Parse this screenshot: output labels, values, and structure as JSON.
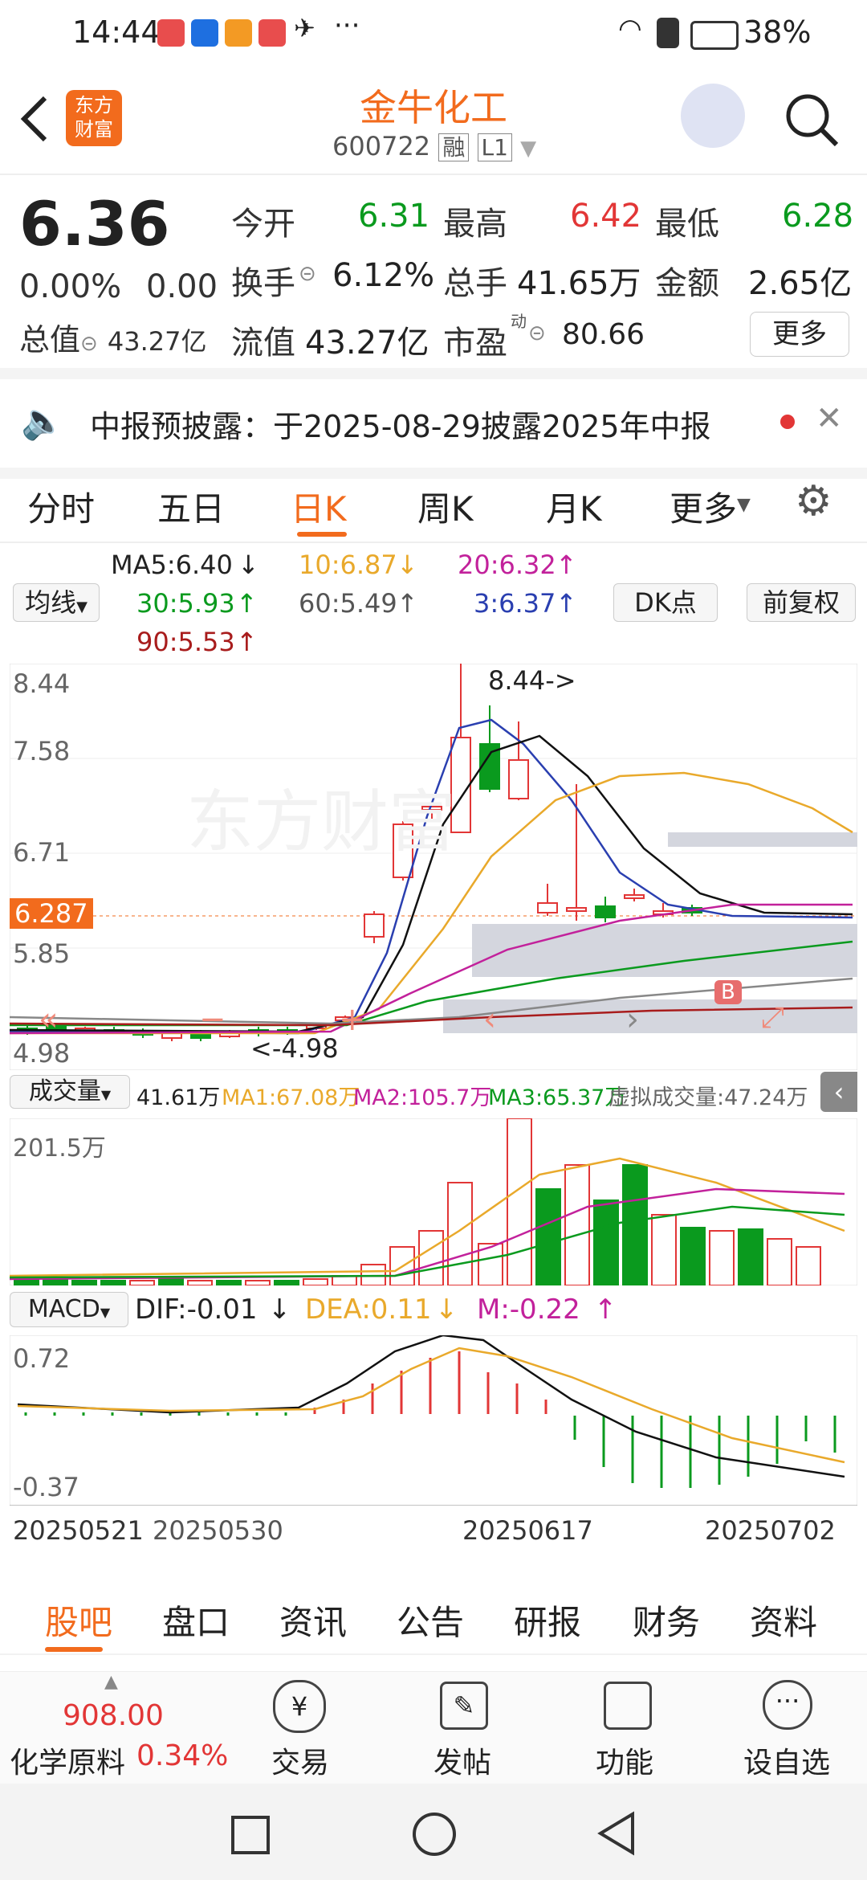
{
  "status": {
    "time": "14:44",
    "battery": "38%"
  },
  "header": {
    "title": "金牛化工",
    "code": "600722",
    "tag1": "融",
    "tag2": "L1",
    "logo_line1": "东方",
    "logo_line2": "财富"
  },
  "quote": {
    "price": "6.36",
    "change_pct": "0.00%",
    "change": "0.00",
    "open_label": "今开",
    "open": "6.31",
    "high_label": "最高",
    "high": "6.42",
    "low_label": "最低",
    "low": "6.28",
    "turnover_label": "换手",
    "turnover": "6.12%",
    "volume_label": "总手",
    "volume": "41.65万",
    "amount_label": "金额",
    "amount": "2.65亿",
    "mktcap_label": "总值",
    "mktcap": "43.27亿",
    "float_label": "流值",
    "float": "43.27亿",
    "pe_label": "市盈",
    "pe_sup": "动",
    "pe": "80.66",
    "more_label": "更多"
  },
  "notice": {
    "text": "中报预披露：于2025-08-29披露2025年中报"
  },
  "tabs": [
    "分时",
    "五日",
    "日K",
    "周K",
    "月K",
    "更多"
  ],
  "ma": {
    "selector": "均线",
    "ma5": "MA5:6.40",
    "ma10": "10:6.87",
    "ma20": "20:6.32",
    "ma30": "30:5.93",
    "ma60": "60:5.49",
    "ma3": "3:6.37",
    "ma90": "90:5.53",
    "dk_label": "DK点",
    "adjust_label": "前复权"
  },
  "kline": {
    "y_ticks": [
      "8.44",
      "7.58",
      "6.71",
      "5.85",
      "4.98"
    ],
    "current_price_tag": "6.287",
    "high_annot": "8.44->",
    "low_annot": "<-4.98",
    "watermark": "东方财富",
    "b_marker": "B"
  },
  "volume": {
    "selector": "成交量",
    "vol": "41.61万",
    "ma1": "MA1:67.08万",
    "ma2": "MA2:105.7万",
    "ma3": "MA3:65.37万",
    "virtual": "虚拟成交量:47.24万",
    "y_max": "201.5万"
  },
  "macd": {
    "selector": "MACD",
    "dif": "DIF:-0.01",
    "dea": "DEA:0.11",
    "m": "M:-0.22",
    "y_max": "0.72",
    "y_min": "-0.37"
  },
  "dates": [
    "20250521",
    "20250530",
    "20250617",
    "20250702"
  ],
  "bottom_tabs": [
    "股吧",
    "盘口",
    "资讯",
    "公告",
    "研报",
    "财务",
    "资料"
  ],
  "footer": {
    "index_value": "908.00",
    "index_name": "化学原料",
    "index_change": "0.34%",
    "trade": "交易",
    "post": "发帖",
    "features": "功能",
    "watch": "设自选"
  },
  "colors": {
    "up": "#e23636",
    "down": "#0a9a1e",
    "accent": "#f26b1d"
  }
}
